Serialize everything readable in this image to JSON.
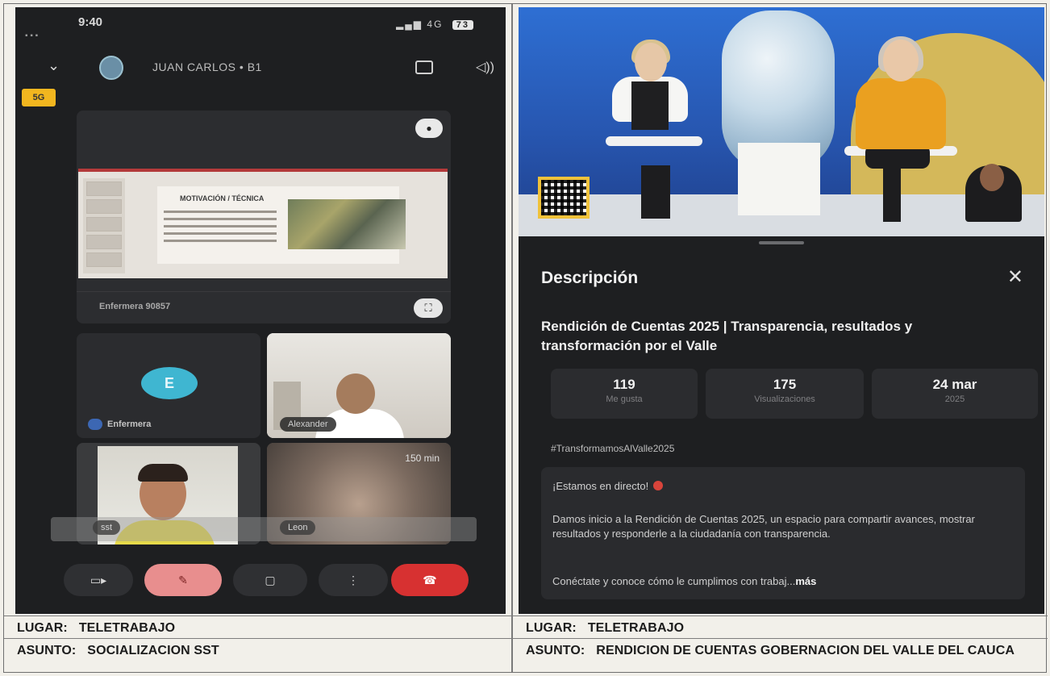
{
  "left_panel": {
    "status": {
      "time": "9:40",
      "signal": "4G",
      "battery": "73"
    },
    "call": {
      "title": "JUAN CARLOS • B1",
      "hd_badge": "5G"
    },
    "screenshare": {
      "presenter_label": "Enfermera 90857"
    },
    "slide": {
      "title": "MOTIVACIÓN / TÉCNICA"
    },
    "tiles": [
      {
        "initial": "E",
        "name": "Enfermera"
      },
      {
        "name": "Alexander"
      },
      {
        "name": ""
      },
      {
        "name": "",
        "duration": "150 min"
      }
    ],
    "strip": [
      "sst",
      "Leon"
    ],
    "controls": {
      "camera": "camera-icon",
      "mic": "mic-off-icon",
      "chat": "chat-icon",
      "more": "more-icon",
      "end": "end-call-icon",
      "accent_end": "#d73131",
      "accent_mic": "#e88e8e"
    }
  },
  "right_panel": {
    "description": {
      "heading": "Descripción",
      "title": "Rendición de Cuentas 2025 | Transparencia, resultados y transformación por el Valle",
      "stats": [
        {
          "value": "119",
          "label": "Me gusta"
        },
        {
          "value": "175",
          "label": "Visualizaciones"
        },
        {
          "value": "24 mar",
          "label": "2025"
        }
      ],
      "hashtag": "#TransformamosAlValle2025",
      "live_text": "¡Estamos en directo!",
      "body": "Damos inicio a la Rendición de Cuentas 2025, un espacio para compartir avances, mostrar resultados y responderle a la ciudadanía con transparencia.",
      "teaser": "Conéctate y conoce cómo le cumplimos con trabaj...",
      "more": "más"
    }
  },
  "captions": {
    "left": {
      "lugar_key": "LUGAR:",
      "lugar_value": "TELETRABAJO",
      "asunto_key": "ASUNTO:",
      "asunto_value": "SOCIALIZACION SST"
    },
    "right": {
      "lugar_key": "LUGAR:",
      "lugar_value": "TELETRABAJO",
      "asunto_key": "ASUNTO:",
      "asunto_value": "RENDICION DE CUENTAS GOBERNACION DEL VALLE DEL CAUCA"
    }
  }
}
